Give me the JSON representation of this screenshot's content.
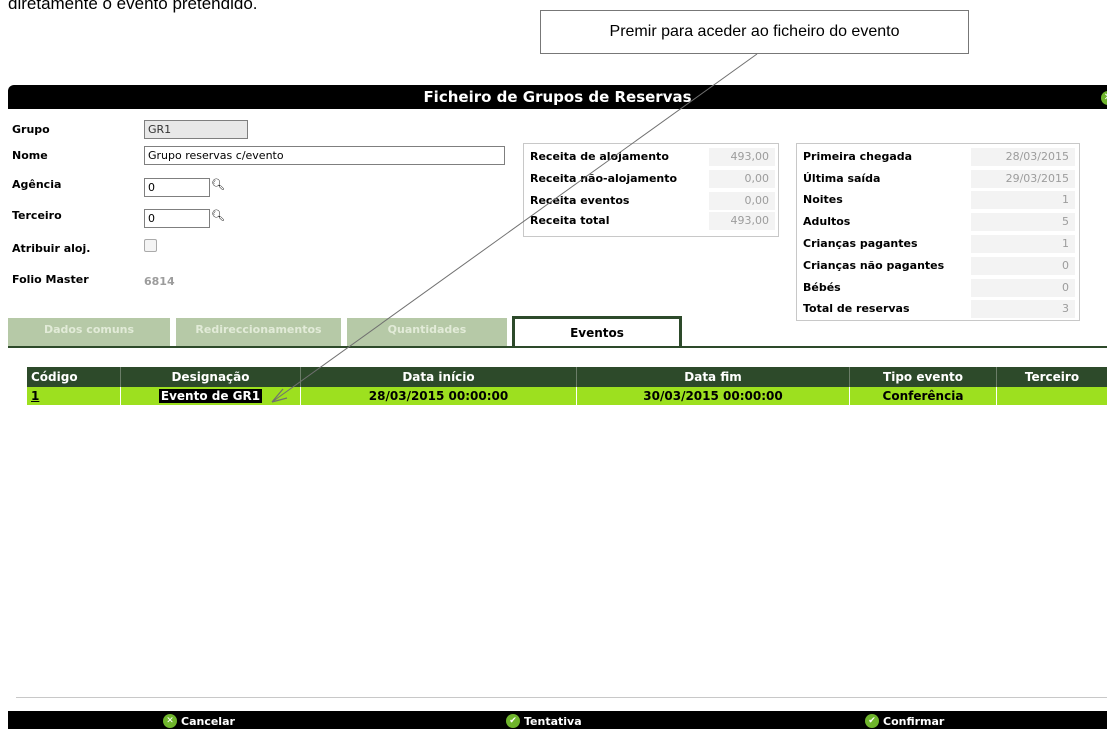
{
  "doc_text": "diretamente o evento pretendido.",
  "callout_text": "Premir para aceder ao ficheiro do evento",
  "window": {
    "title": "Ficheiro de Grupos de Reservas"
  },
  "form": {
    "grupo_label": "Grupo",
    "grupo_value": "GR1",
    "nome_label": "Nome",
    "nome_value": "Grupo reservas c/evento",
    "agencia_label": "Agência",
    "agencia_value": "0",
    "terceiro_label": "Terceiro",
    "terceiro_value": "0",
    "atribuir_label": "Atribuir aloj.",
    "folio_label": "Folio Master",
    "folio_value": "6814"
  },
  "receitas": [
    {
      "label": "Receita de alojamento",
      "value": "493,00"
    },
    {
      "label": "Receita não-alojamento",
      "value": "0,00"
    },
    {
      "label": "Receita eventos",
      "value": "0,00"
    },
    {
      "label": "Receita total",
      "value": "493,00"
    }
  ],
  "stats": [
    {
      "label": "Primeira chegada",
      "value": "28/03/2015"
    },
    {
      "label": "Última saída",
      "value": "29/03/2015"
    },
    {
      "label": "Noites",
      "value": "1"
    },
    {
      "label": "Adultos",
      "value": "5"
    },
    {
      "label": "Crianças pagantes",
      "value": "1"
    },
    {
      "label": "Crianças não pagantes",
      "value": "0"
    },
    {
      "label": "Bébés",
      "value": "0"
    },
    {
      "label": "Total de reservas",
      "value": "3"
    }
  ],
  "tabs": [
    "Dados comuns",
    "Redireccionamentos",
    "Quantidades",
    "Eventos"
  ],
  "active_tab": "Eventos",
  "grid": {
    "headers": [
      "Código",
      "Designação",
      "Data início",
      "Data fim",
      "Tipo evento",
      "Terceiro"
    ],
    "rows": [
      {
        "codigo": "1",
        "designacao": "Evento de GR1",
        "inicio": "28/03/2015 00:00:00",
        "fim": "30/03/2015 00:00:00",
        "tipo": "Conferência",
        "terceiro": ""
      }
    ]
  },
  "footer": {
    "cancel": "Cancelar",
    "tentative": "Tentativa",
    "confirm": "Confirmar"
  },
  "colors": {
    "dark_green": "#2d4a2a",
    "row_highlight": "#9de01f",
    "icon_green": "#6fb52c"
  }
}
